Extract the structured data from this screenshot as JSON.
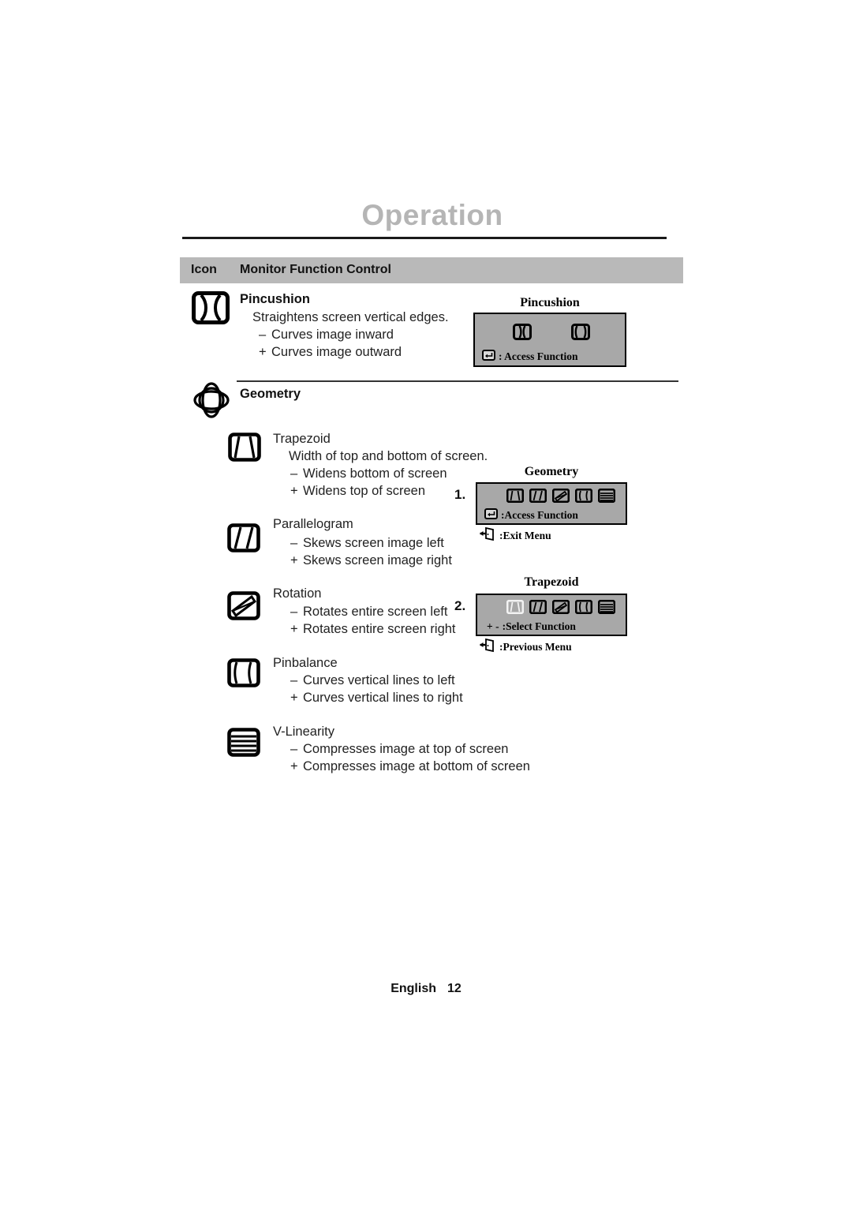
{
  "document": {
    "title": "Operation",
    "footer_language": "English",
    "footer_page": "12"
  },
  "table": {
    "header": {
      "icon_column": "Icon",
      "control_column": "Monitor Function Control"
    }
  },
  "sections": [
    {
      "id": "pincushion",
      "icon": "pincushion-icon",
      "title": "Pincushion",
      "description": "Straightens screen vertical edges.",
      "bullets": [
        {
          "sign": "–",
          "text": "Curves image inward"
        },
        {
          "sign": "+",
          "text": "Curves image outward"
        }
      ]
    },
    {
      "id": "geometry",
      "icon": "geometry-globe-icon",
      "title": "Geometry",
      "items": [
        {
          "id": "trapezoid",
          "icon": "trapezoid-icon",
          "name": "Trapezoid",
          "description": "Width of top and bottom of screen.",
          "bullets": [
            {
              "sign": "–",
              "text": "Widens bottom of screen"
            },
            {
              "sign": "+",
              "text": "Widens top of screen"
            }
          ]
        },
        {
          "id": "parallelogram",
          "icon": "parallelogram-icon",
          "name": "Parallelogram",
          "description": "",
          "bullets": [
            {
              "sign": "–",
              "text": "Skews screen image left"
            },
            {
              "sign": "+",
              "text": "Skews screen image right"
            }
          ]
        },
        {
          "id": "rotation",
          "icon": "rotation-icon",
          "name": "Rotation",
          "description": "",
          "bullets": [
            {
              "sign": "–",
              "text": "Rotates entire screen left"
            },
            {
              "sign": "+",
              "text": "Rotates entire screen right"
            }
          ]
        },
        {
          "id": "pinbalance",
          "icon": "pinbalance-icon",
          "name": "Pinbalance",
          "description": "",
          "bullets": [
            {
              "sign": "–",
              "text": "Curves vertical lines to left"
            },
            {
              "sign": "+",
              "text": "Curves vertical lines to right"
            }
          ]
        },
        {
          "id": "v-linearity",
          "icon": "v-linearity-icon",
          "name": "V-Linearity",
          "description": "",
          "bullets": [
            {
              "sign": "–",
              "text": "Compresses image at top of screen"
            },
            {
              "sign": "+",
              "text": "Compresses image at bottom of screen"
            }
          ]
        }
      ]
    }
  ],
  "osd_panels": [
    {
      "id": "osd-pincushion",
      "caption": "Pincushion",
      "step": "",
      "icons": [
        "pincushion-in-icon",
        "pincushion-out-icon"
      ],
      "legend": [
        {
          "key": "enter-key-icon",
          "label": ": Access Function"
        }
      ]
    },
    {
      "id": "osd-geometry",
      "caption": "Geometry",
      "step": "1.",
      "icons": [
        "trapezoid-icon",
        "parallelogram-icon",
        "rotation-icon",
        "pinbalance-icon",
        "v-linearity-icon"
      ],
      "legend": [
        {
          "key": "enter-key-icon",
          "label": ":Access Function"
        },
        {
          "key": "exit-door-icon",
          "label": ":Exit Menu"
        }
      ]
    },
    {
      "id": "osd-trapezoid",
      "caption": "Trapezoid",
      "step": "2.",
      "icons": [
        "trapezoid-icon-selected",
        "parallelogram-icon",
        "rotation-icon",
        "pinbalance-icon",
        "v-linearity-icon"
      ],
      "legend": [
        {
          "key": "plus-minus-keys",
          "label": ":Select Function",
          "prefix": "+ -"
        },
        {
          "key": "exit-door-icon",
          "label": ":Previous Menu"
        }
      ]
    }
  ],
  "colors": {
    "title_gray": "#b5b5b5",
    "header_band": "#b9b9b9",
    "osd_background": "#a8a8a8",
    "text": "#111111"
  }
}
